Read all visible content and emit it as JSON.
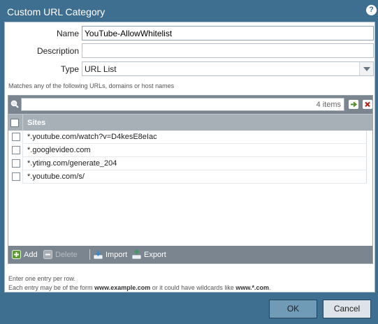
{
  "dialog": {
    "title": "Custom URL Category",
    "help_icon": "?"
  },
  "form": {
    "name_label": "Name",
    "name_value": "YouTube-AllowWhitelist",
    "description_label": "Description",
    "description_value": "",
    "type_label": "Type",
    "type_value": "URL List"
  },
  "hint": "Matches any of the following URLs, domains or host names",
  "grid": {
    "search_placeholder": "",
    "item_count": "4 items",
    "column_header": "Sites",
    "rows": [
      "*.youtube.com/watch?v=D4kesE8eIac",
      "*.googlevideo.com",
      "*.ytimg.com/generate_204",
      "*.youtube.com/s/"
    ]
  },
  "grid_actions": {
    "add": "Add",
    "delete": "Delete",
    "import": "Import",
    "export": "Export"
  },
  "notes": {
    "line1": "Enter one entry per row.",
    "line2_prefix": "Each entry may be of the form ",
    "line2_example1": "www.example.com",
    "line2_middle": " or it could have wildcards like ",
    "line2_example2": "www.*.com",
    "line2_suffix": "."
  },
  "buttons": {
    "ok": "OK",
    "cancel": "Cancel"
  },
  "colors": {
    "frame": "#3f6f90",
    "grid_bar": "#7a8590",
    "ok_button": "#6f9bb6"
  }
}
